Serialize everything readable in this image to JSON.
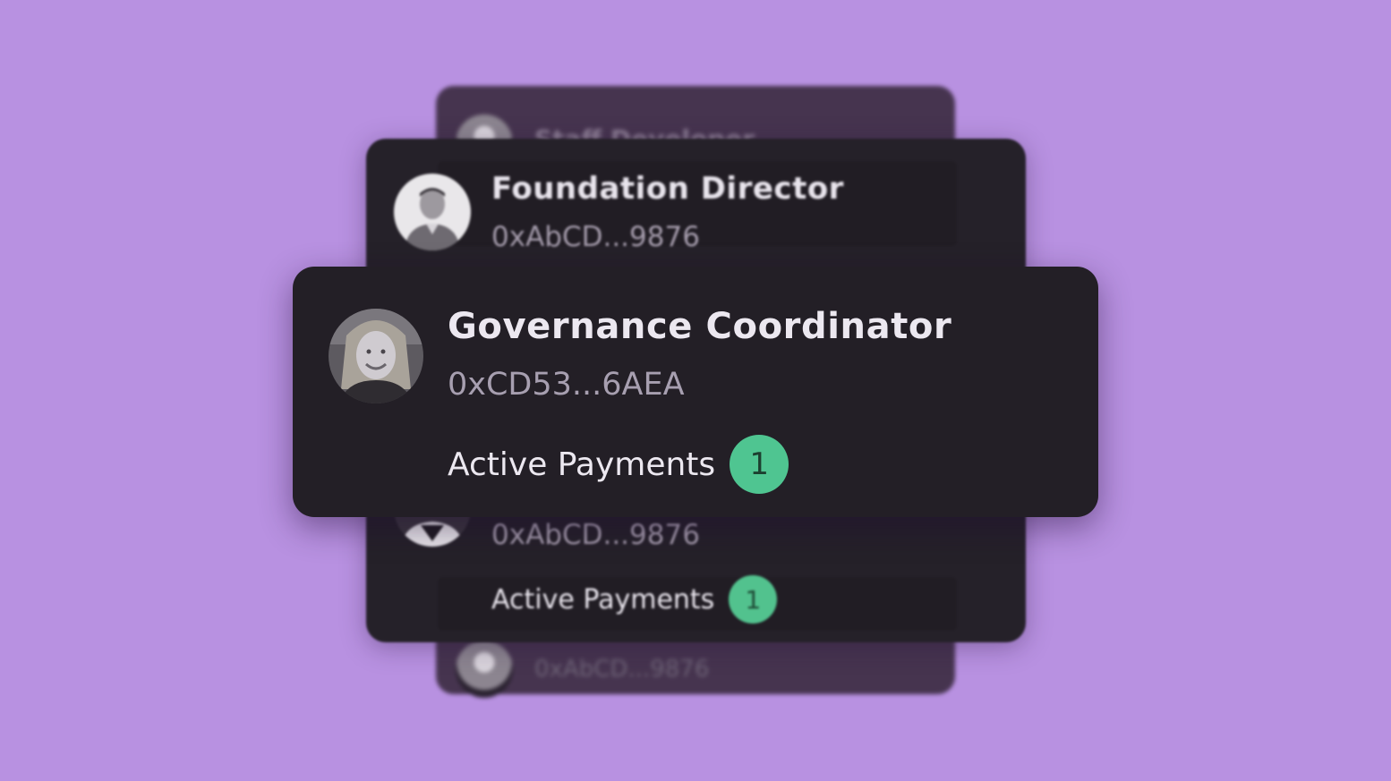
{
  "colors": {
    "background": "#b891e1",
    "card": "#231f26",
    "badge": "#4fc591",
    "text_primary": "#ece8f0",
    "text_secondary": "#a79fb0"
  },
  "back_card": {
    "top_label": "Staff Developer",
    "bottom_label": "0xAbCD...9876"
  },
  "middle_card": {
    "title": "Foundation Director",
    "address": "0xAbCD...9876",
    "second_address": "0xAbCD...9876",
    "payments_label": "Active Payments",
    "payments_count": "1"
  },
  "front_card": {
    "title": "Governance Coordinator",
    "address": "0xCD53...6AEA",
    "payments_label": "Active Payments",
    "payments_count": "1"
  }
}
